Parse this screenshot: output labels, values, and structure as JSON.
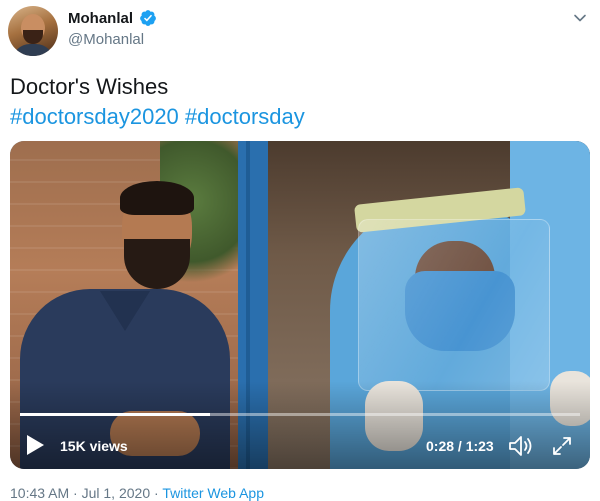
{
  "author": {
    "name": "Mohanlal",
    "handle": "@Mohanlal",
    "verified": true,
    "icons": {
      "verified": "verified-badge-icon",
      "menu": "chevron-down-icon",
      "avatar": "profile-avatar"
    }
  },
  "tweet": {
    "line1": "Doctor's Wishes",
    "hashtags": [
      "#doctorsday2020",
      "#doctorsday"
    ]
  },
  "video": {
    "views": "15K views",
    "time_display": "0:28 / 1:23",
    "progress_fraction": 0.34,
    "icons": {
      "play": "play-icon",
      "volume": "volume-icon",
      "fullscreen": "fullscreen-icon"
    }
  },
  "meta": {
    "time": "10:43 AM",
    "separator": " · ",
    "date": "Jul 1, 2020",
    "source": "Twitter Web App"
  },
  "colors": {
    "accent": "#1b95e0",
    "secondary_text": "#657786",
    "primary_text": "#14171a"
  }
}
